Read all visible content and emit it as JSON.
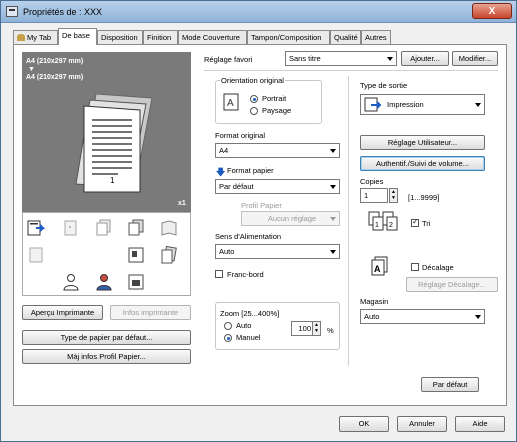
{
  "window": {
    "title": "Propriétés de : XXX",
    "close_glyph": "X"
  },
  "tabs": [
    {
      "label": "My Tab"
    },
    {
      "label": "De base"
    },
    {
      "label": "Disposition"
    },
    {
      "label": "Finition"
    },
    {
      "label": "Mode Couverture"
    },
    {
      "label": "Tampon/Composition"
    },
    {
      "label": "Qualité"
    },
    {
      "label": "Autres"
    }
  ],
  "preview": {
    "line1": "A4 (210x297 mm)",
    "arrow": "▼",
    "line2": "A4 (210x297 mm)",
    "copies_badge": "x1",
    "page_number": "1"
  },
  "left_buttons": {
    "print_preview": "Aperçu Imprimante",
    "printer_info": "Infos imprimante",
    "default_paper_type": "Type de papier par défaut...",
    "update_paper_profile": "Màj infos Profil Papier..."
  },
  "favorite": {
    "label": "Réglage favori",
    "value": "Sans titre",
    "add": "Ajouter...",
    "modify": "Modifier..."
  },
  "orientation": {
    "label": "Orientation original",
    "portrait": "Portrait",
    "landscape": "Paysage",
    "selected": "Portrait"
  },
  "original_size": {
    "label": "Format original",
    "value": "A4"
  },
  "paper_size": {
    "label": "Format papier",
    "value": "Par défaut"
  },
  "paper_profile": {
    "label": "Profil Papier",
    "value": "Aucun réglage"
  },
  "feed_direction": {
    "label": "Sens d'Alimentation",
    "value": "Auto"
  },
  "borderless": {
    "label": "Franc-bord",
    "checked": false
  },
  "zoom": {
    "label": "Zoom [25...400%]",
    "auto": "Auto",
    "manual": "Manuel",
    "selected": "Manuel",
    "value": "100",
    "unit": "%"
  },
  "output_type": {
    "label": "Type de sortie",
    "value": "Impression"
  },
  "user_settings": "Réglage Utilisateur...",
  "auth": "Authentif./Suivi de volume...",
  "copies": {
    "label": "Copies",
    "value": "1",
    "range": "[1...9999]"
  },
  "collate": {
    "label": "Tri",
    "checked": true
  },
  "offset": {
    "label": "Décalage",
    "checked": false,
    "settings": "Réglage Décalage..."
  },
  "tray": {
    "label": "Magasin",
    "value": "Auto"
  },
  "default_button": "Par défaut",
  "dialog": {
    "ok": "OK",
    "cancel": "Annuler",
    "help": "Aide"
  }
}
